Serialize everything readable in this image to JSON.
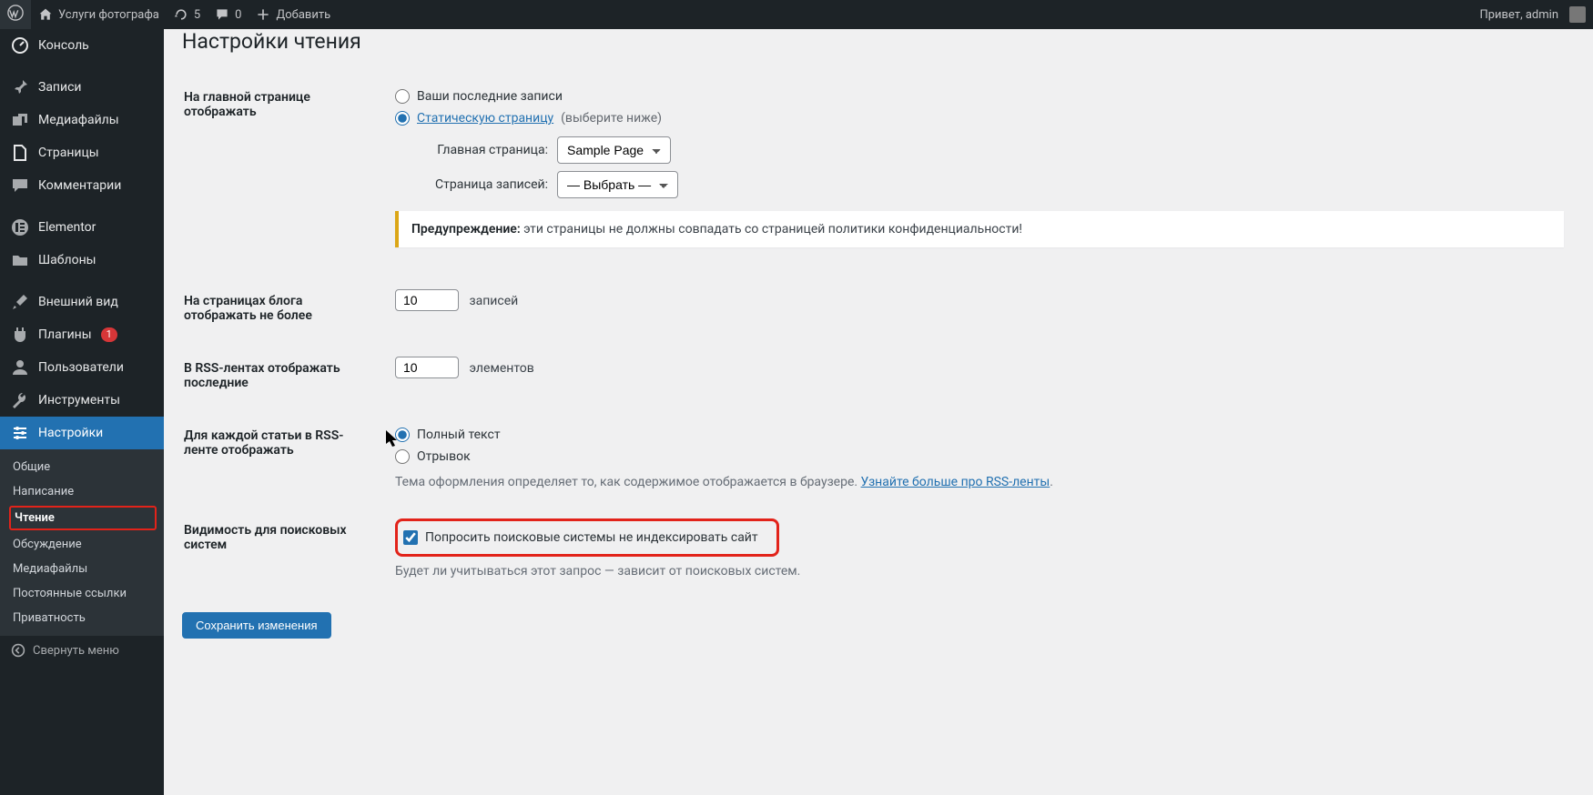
{
  "topbar": {
    "site_name": "Услуги фотографа",
    "updates_count": "5",
    "comments_count": "0",
    "add_new": "Добавить",
    "greeting": "Привет, admin"
  },
  "sidebar": {
    "items": [
      {
        "icon": "dashboard",
        "label": "Консоль"
      },
      {
        "icon": "pin",
        "label": "Записи"
      },
      {
        "icon": "media",
        "label": "Медиафайлы"
      },
      {
        "icon": "page",
        "label": "Страницы"
      },
      {
        "icon": "comment",
        "label": "Комментарии"
      },
      {
        "icon": "elementor",
        "label": "Elementor"
      },
      {
        "icon": "folder",
        "label": "Шаблоны"
      },
      {
        "icon": "brush",
        "label": "Внешний вид"
      },
      {
        "icon": "plugin",
        "label": "Плагины",
        "badge": "1"
      },
      {
        "icon": "user",
        "label": "Пользователи"
      },
      {
        "icon": "wrench",
        "label": "Инструменты"
      },
      {
        "icon": "settings",
        "label": "Настройки"
      }
    ],
    "submenu": [
      "Общие",
      "Написание",
      "Чтение",
      "Обсуждение",
      "Медиафайлы",
      "Постоянные ссылки",
      "Приватность"
    ],
    "collapse": "Свернуть меню"
  },
  "page": {
    "title": "Настройки чтения",
    "row1_label": "На главной странице отображать",
    "radio_posts": "Ваши последние записи",
    "radio_static": "Статическую страницу",
    "radio_static_suffix": "(выберите ниже)",
    "homepage_label": "Главная страница:",
    "homepage_value": "Sample Page",
    "postspage_label": "Страница записей:",
    "postspage_value": "— Выбрать —",
    "warning_b": "Предупреждение:",
    "warning_text": " эти страницы не должны совпадать со страницей политики конфиденциальности!",
    "row2_label": "На страницах блога отображать не более",
    "blog_count": "10",
    "blog_unit": "записей",
    "row3_label": "В RSS-лентах отображать последние",
    "rss_count": "10",
    "rss_unit": "элементов",
    "row4_label": "Для каждой статьи в RSS-ленте отображать",
    "rss_full": "Полный текст",
    "rss_excerpt": "Отрывок",
    "rss_desc_pre": "Тема оформления определяет то, как содержимое отображается в браузере. ",
    "rss_desc_link": "Узнайте больше про RSS-ленты",
    "row5_label": "Видимость для поисковых систем",
    "search_checkbox": "Попросить поисковые системы не индексировать сайт",
    "search_desc": "Будет ли учитываться этот запрос — зависит от поисковых систем.",
    "save": "Сохранить изменения"
  }
}
